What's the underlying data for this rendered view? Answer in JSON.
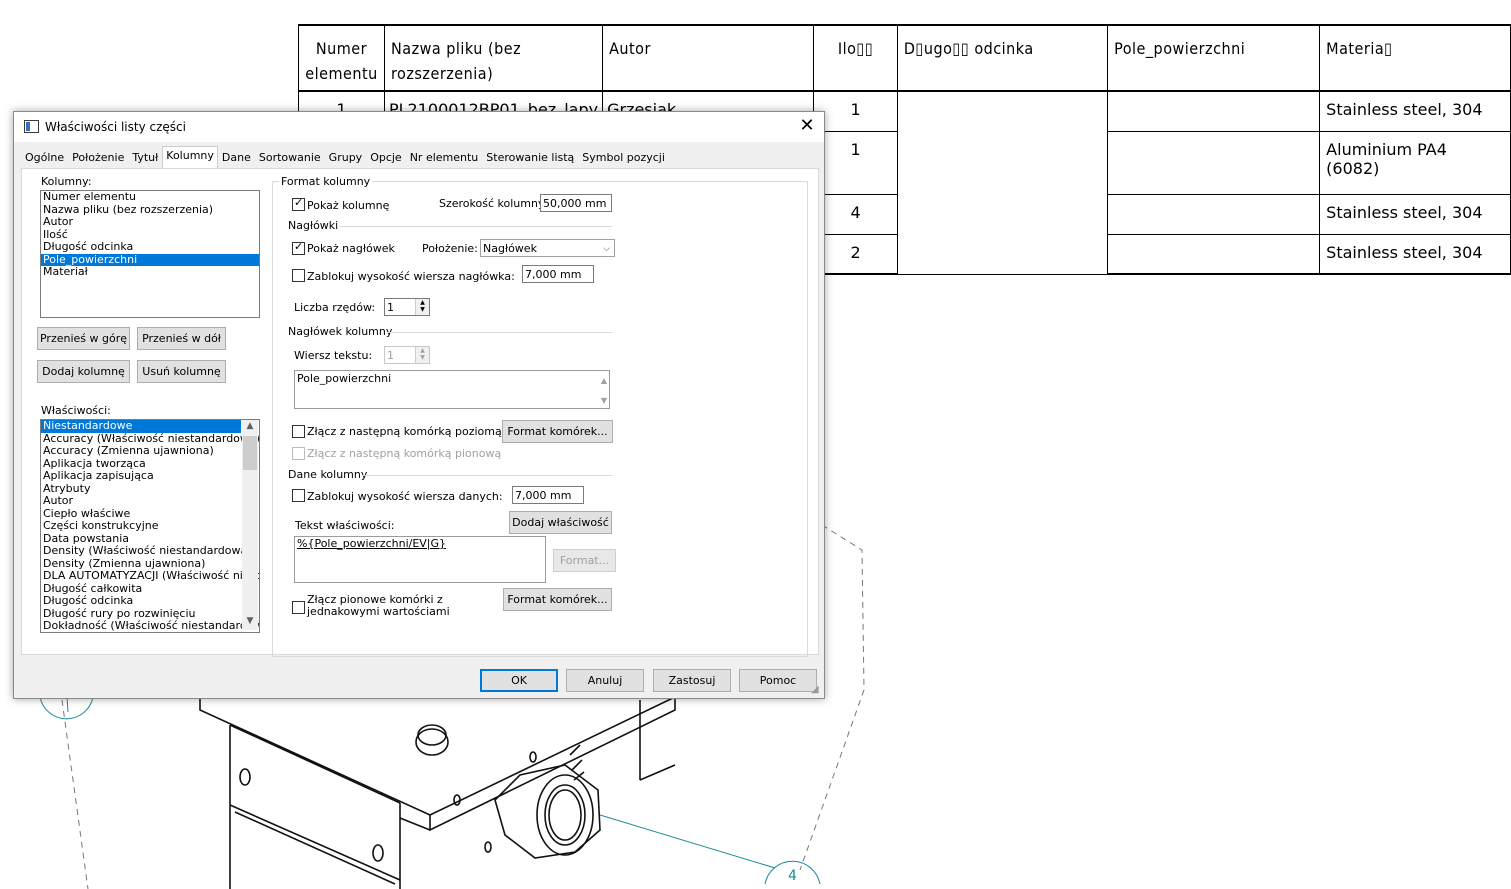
{
  "bom": {
    "headers": [
      "Numer\nelementu",
      "Nazwa pliku (bez\nrozszerzenia)",
      "Autor",
      "Ilo▯▯",
      "D▯ugo▯▯ odcinka",
      "Pole_powierzchni",
      "Materia▯"
    ],
    "rows": [
      {
        "num": "1",
        "name": "PL2100012BP01_bez_lapy",
        "author": "Grzesiak",
        "qty": "1",
        "mat": "Stainless steel, 304"
      },
      {
        "num": "",
        "name": "",
        "author": "",
        "qty": "1",
        "mat": "Aluminium PA4 (6082)"
      },
      {
        "num": "",
        "name": "",
        "author": "",
        "qty": "4",
        "mat": "Stainless steel, 304"
      },
      {
        "num": "",
        "name": "",
        "author": "",
        "qty": "2",
        "mat": "Stainless steel, 304"
      }
    ],
    "balloons": [
      "1",
      "4"
    ]
  },
  "dialog": {
    "title": "Właściwości listy części",
    "close_glyph": "✕",
    "tabs": [
      "Ogólne",
      "Położenie",
      "Tytuł",
      "Kolumny",
      "Dane",
      "Sortowanie",
      "Grupy",
      "Opcje",
      "Nr elementu",
      "Sterowanie listą",
      "Symbol pozycji"
    ],
    "active_tab": "Kolumny",
    "columns_label": "Kolumny:",
    "columns": [
      "Numer elementu",
      "Nazwa pliku (bez rozszerzenia)",
      "Autor",
      "Ilość",
      "Długość odcinka",
      "Pole_powierzchni",
      "Materiał"
    ],
    "selected_column": "Pole_powierzchni",
    "move_up": "Przenieś w górę",
    "move_down": "Przenieś w dół",
    "add_column": "Dodaj kolumnę",
    "remove_column": "Usuń kolumnę",
    "properties_label": "Właściwości:",
    "properties": [
      "Niestandardowe",
      "Accuracy (Właściwość niestandardowa)",
      "Accuracy (Zmienna ujawniona)",
      "Aplikacja tworząca",
      "Aplikacja zapisująca",
      "Atrybuty",
      "Autor",
      "Ciepło właściwe",
      "Części konstrukcyjne",
      "Data powstania",
      "Density (Właściwość niestandardowa)",
      "Density (Zmienna ujawniona)",
      "DLA AUTOMATYZACJI (Właściwość niestandardowa)",
      "Długość całkowita",
      "Długość odcinka",
      "Długość rury po rozwinięciu",
      "Dokładność (Właściwość niestandardowa)"
    ],
    "selected_property": "Niestandardowe",
    "format_group": "Format kolumny",
    "show_column": "Pokaż kolumnę",
    "show_column_checked": true,
    "column_width_label": "Szerokość kolumny:",
    "column_width": "50,000 mm",
    "headers_group": "Nagłówki",
    "show_header": "Pokaż nagłówek",
    "show_header_checked": true,
    "position_label": "Położenie:",
    "position_value": "Nagłówek",
    "lock_header_height": "Zablokuj wysokość wiersza nagłówka:",
    "lock_header_checked": false,
    "header_height": "7,000 mm",
    "rows_count_label": "Liczba rzędów:",
    "rows_count": "1",
    "col_header_group": "Nagłówek kolumny",
    "text_row_label": "Wiersz tekstu:",
    "text_row": "1",
    "header_text": "Pole_powierzchni",
    "merge_horizontal": "Złącz z następną komórką poziomą",
    "cell_format_btn": "Format komórek...",
    "merge_vertical": "Złącz z następną komórką pionową",
    "data_group": "Dane kolumny",
    "lock_data_height": "Zablokuj wysokość wiersza danych:",
    "data_height": "7,000 mm",
    "property_text_label": "Tekst właściwości:",
    "add_property_btn": "Dodaj właściwość",
    "property_text": "%{Pole_powierzchni/EV|G}",
    "format_btn": "Format...",
    "merge_equal_line1": "Złącz pionowe komórki z",
    "merge_equal_line2": "jednakowymi wartościami",
    "cell_format_btn2": "Format komórek...",
    "ok": "OK",
    "cancel": "Anuluj",
    "apply": "Zastosuj",
    "help": "Pomoc"
  }
}
